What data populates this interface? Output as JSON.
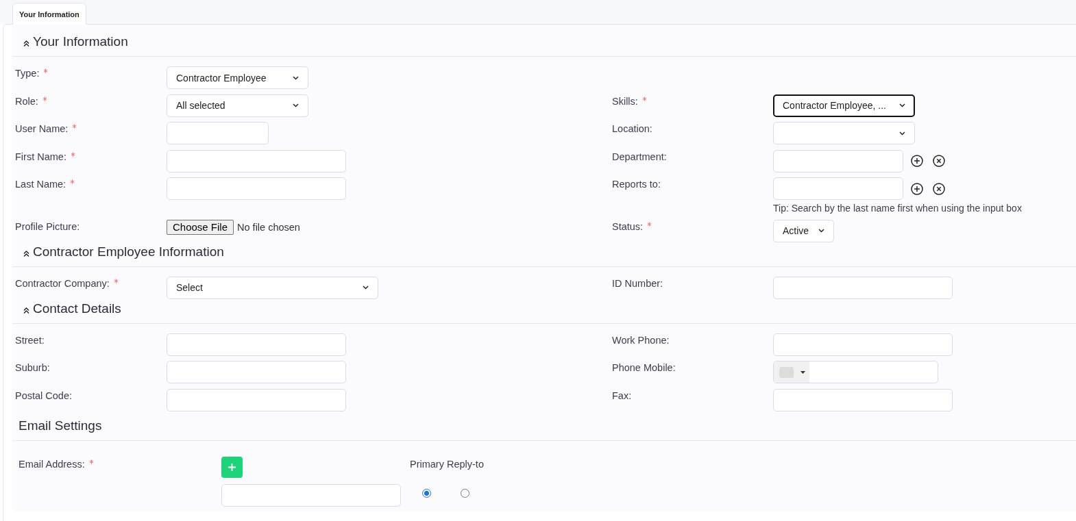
{
  "tabs": [
    {
      "label": "Your Information",
      "selected": true
    }
  ],
  "sections": [
    {
      "kind": "form",
      "title": "Your Information",
      "collapsible": true,
      "rows": [
        {
          "left": {
            "label": "Type:",
            "required": true,
            "kind": "select",
            "value": "Contractor Employee",
            "focused": false
          }
        },
        {
          "left": {
            "label": "Role:",
            "required": true,
            "kind": "select",
            "value": "All selected",
            "focused": false
          },
          "right": {
            "label": "Skills:",
            "required": true,
            "kind": "select",
            "value": "Contractor Employee, ...",
            "focused": true
          }
        },
        {
          "left": {
            "label": "User Name:",
            "required": true,
            "kind": "text",
            "focused": false
          },
          "right": {
            "label": "Location:",
            "required": false,
            "kind": "select",
            "focused": false
          }
        },
        {
          "left": {
            "label": "First Name:",
            "required": true,
            "kind": "text",
            "focused": false
          },
          "right": {
            "label": "Department:",
            "required": false,
            "kind": "lookup",
            "focused": false
          }
        },
        {
          "left": {
            "label": "Last Name:",
            "required": true,
            "kind": "text",
            "focused": false
          },
          "right": {
            "label": "Reports to:",
            "required": false,
            "kind": "lookup",
            "focused": false,
            "hint": "Tip: Search by the last name first when using the input box"
          }
        },
        {
          "left": {
            "label": "Profile Picture:",
            "required": false,
            "kind": "file",
            "focused": false,
            "button": "Choose File",
            "status": "No file chosen"
          },
          "right": {
            "label": "Status:",
            "required": true,
            "kind": "select",
            "value": "Active",
            "focused": false
          }
        }
      ]
    },
    {
      "kind": "form",
      "title": "Contractor Employee Information",
      "collapsible": true,
      "rows": [
        {
          "left": {
            "label": "Contractor Company:",
            "required": true,
            "kind": "select",
            "value": "Select",
            "focused": false
          },
          "right": {
            "label": "ID Number:",
            "required": false,
            "kind": "text",
            "focused": false
          }
        }
      ]
    },
    {
      "kind": "form",
      "title": "Contact Details",
      "collapsible": true,
      "rows": [
        {
          "left": {
            "label": "Street:",
            "required": false,
            "kind": "text",
            "focused": false
          },
          "right": {
            "label": "Work Phone:",
            "required": false,
            "kind": "text",
            "focused": false
          }
        },
        {
          "left": {
            "label": "Suburb:",
            "required": false,
            "kind": "text",
            "focused": false
          },
          "right": {
            "label": "Phone Mobile:",
            "required": false,
            "kind": "phone",
            "focused": false
          }
        },
        {
          "left": {
            "label": "Postal Code:",
            "required": false,
            "kind": "text",
            "focused": false
          },
          "right": {
            "label": "Fax:",
            "required": false,
            "kind": "text",
            "focused": false
          }
        }
      ]
    },
    {
      "kind": "email",
      "title": "Email Settings",
      "collapsible": false,
      "field": {
        "label": "Email Address:",
        "required": true,
        "focused": false
      },
      "options": [
        {
          "label": "Primary",
          "selected": true
        },
        {
          "label": "Reply-to",
          "selected": false
        }
      ]
    }
  ]
}
